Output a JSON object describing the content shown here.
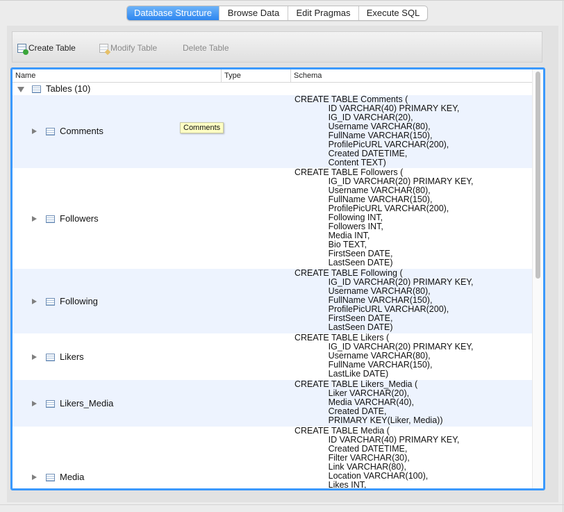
{
  "tabs": [
    {
      "label": "Database Structure",
      "active": true
    },
    {
      "label": "Browse Data",
      "active": false
    },
    {
      "label": "Edit Pragmas",
      "active": false
    },
    {
      "label": "Execute SQL",
      "active": false
    }
  ],
  "toolbar": {
    "create_label": "Create Table",
    "modify_label": "Modify Table",
    "delete_label": "Delete Table"
  },
  "columns": {
    "name": "Name",
    "type": "Type",
    "schema": "Schema"
  },
  "tree": {
    "root_label": "Tables (10)",
    "rows": [
      {
        "name": "Comments",
        "schema": "CREATE TABLE Comments (\n              ID VARCHAR(40) PRIMARY KEY,\n              IG_ID VARCHAR(20),\n              Username VARCHAR(80),\n              FullName VARCHAR(150),\n              ProfilePicURL VARCHAR(200),\n              Created DATETIME,\n              Content TEXT)"
      },
      {
        "name": "Followers",
        "schema": "CREATE TABLE Followers (\n              IG_ID VARCHAR(20) PRIMARY KEY,\n              Username VARCHAR(80),\n              FullName VARCHAR(150),\n              ProfilePicURL VARCHAR(200),\n              Following INT,\n              Followers INT,\n              Media INT,\n              Bio TEXT,\n              FirstSeen DATE,\n              LastSeen DATE)"
      },
      {
        "name": "Following",
        "schema": "CREATE TABLE Following (\n              IG_ID VARCHAR(20) PRIMARY KEY,\n              Username VARCHAR(80),\n              FullName VARCHAR(150),\n              ProfilePicURL VARCHAR(200),\n              FirstSeen DATE,\n              LastSeen DATE)"
      },
      {
        "name": "Likers",
        "schema": "CREATE TABLE Likers (\n              IG_ID VARCHAR(20) PRIMARY KEY,\n              Username VARCHAR(80),\n              FullName VARCHAR(150),\n              LastLike DATE)"
      },
      {
        "name": "Likers_Media",
        "schema": "CREATE TABLE Likers_Media (\n              Liker VARCHAR(20),\n              Media VARCHAR(40),\n              Created DATE,\n              PRIMARY KEY(Liker, Media))"
      },
      {
        "name": "Media",
        "schema": "CREATE TABLE Media (\n              ID VARCHAR(40) PRIMARY KEY,\n              Created DATETIME,\n              Filter VARCHAR(30),\n              Link VARCHAR(80),\n              Location VARCHAR(100),\n              Likes INT,"
      }
    ]
  },
  "tooltip": "Comments"
}
